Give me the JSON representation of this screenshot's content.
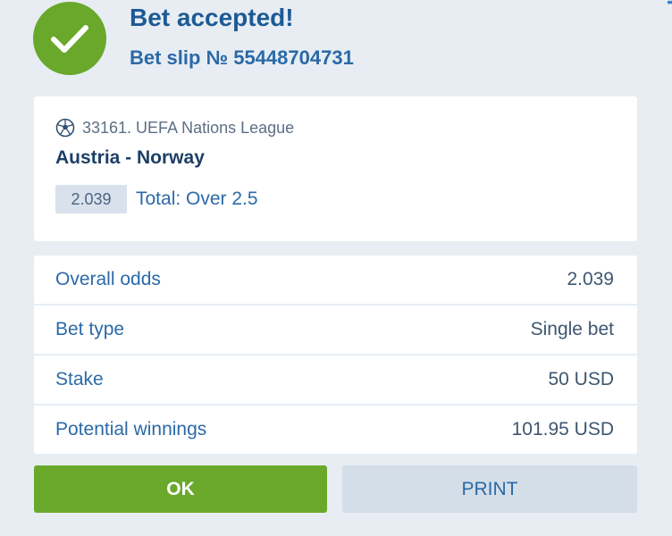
{
  "header": {
    "title": "Bet accepted!",
    "slip_label": "Bet slip № 55448704731"
  },
  "event": {
    "league": "33161. UEFA Nations League",
    "match": "Austria - Norway",
    "odds": "2.039",
    "market": "Total: Over 2.5",
    "sport_icon": "soccer-ball-icon"
  },
  "details": [
    {
      "label": "Overall odds",
      "value": "2.039"
    },
    {
      "label": "Bet type",
      "value": "Single bet"
    },
    {
      "label": "Stake",
      "value": "50 USD"
    },
    {
      "label": "Potential winnings",
      "value": "101.95 USD"
    }
  ],
  "buttons": {
    "ok": "OK",
    "print": "PRINT"
  },
  "colors": {
    "accent_green": "#6aa82b",
    "brand_blue": "#2b69a6",
    "background": "#e7edf3"
  }
}
